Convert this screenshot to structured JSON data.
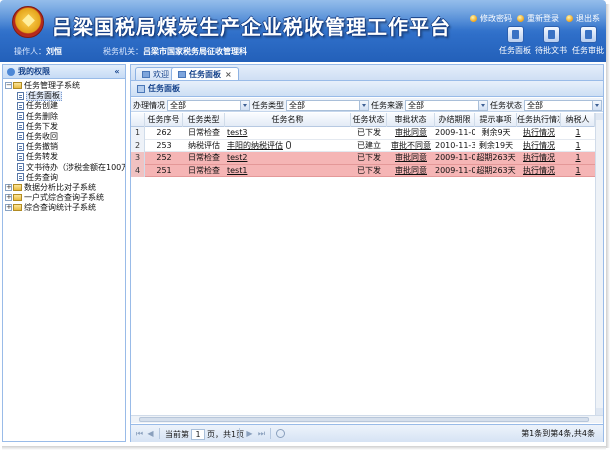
{
  "header": {
    "title": "吕梁国税局煤炭生产企业税收管理工作平台",
    "links": [
      {
        "label": "修改密码"
      },
      {
        "label": "重新登录"
      },
      {
        "label": "退出系"
      }
    ],
    "user_label": "操作人：",
    "user_name": "刘恒",
    "org_label": "税务机关：",
    "org_name": "吕梁市国家税务局征收管理科",
    "quick_buttons": [
      {
        "label": "任务面板"
      },
      {
        "label": "待批文书"
      },
      {
        "label": "任务审批"
      }
    ]
  },
  "sidebar": {
    "title": "我的权限",
    "collapse": "«",
    "tree": [
      {
        "label": "任务管理子系统",
        "level": 0,
        "type": "folder",
        "expanded": true
      },
      {
        "label": "任务面板",
        "level": 1,
        "type": "leaf",
        "selected": true
      },
      {
        "label": "任务创建",
        "level": 1,
        "type": "leaf"
      },
      {
        "label": "任务删除",
        "level": 1,
        "type": "leaf"
      },
      {
        "label": "任务下发",
        "level": 1,
        "type": "leaf"
      },
      {
        "label": "任务收回",
        "level": 1,
        "type": "leaf"
      },
      {
        "label": "任务撤销",
        "level": 1,
        "type": "leaf"
      },
      {
        "label": "任务转发",
        "level": 1,
        "type": "leaf"
      },
      {
        "label": "文书待办（涉税金额在100万",
        "level": 1,
        "type": "leaf"
      },
      {
        "label": "任务查询",
        "level": 1,
        "type": "leaf"
      },
      {
        "label": "数据分析比对子系统",
        "level": 0,
        "type": "folder",
        "expanded": false
      },
      {
        "label": "一户式综合查询子系统",
        "level": 0,
        "type": "folder",
        "expanded": false
      },
      {
        "label": "综合查询统计子系统",
        "level": 0,
        "type": "folder",
        "expanded": false
      }
    ]
  },
  "tabs": [
    {
      "label": "欢迎",
      "active": false
    },
    {
      "label": "任务面板",
      "active": true,
      "close": "×"
    }
  ],
  "panel": {
    "title": "任务面板",
    "filters": [
      {
        "label": "办理情况",
        "value": "全部"
      },
      {
        "label": "任务类型",
        "value": "全部"
      },
      {
        "label": "任务来源",
        "value": "全部"
      },
      {
        "label": "任务状态",
        "value": "全部"
      }
    ],
    "columns": [
      "",
      "任务序号",
      "任务类型",
      "任务名称",
      "任务状态",
      "审批状态",
      "办结期限",
      "提示事项",
      "任务执行情况",
      "纳税人"
    ],
    "rows": [
      {
        "num": "1",
        "id": "262",
        "type": "日常检查",
        "name": "test3",
        "status": "已下发",
        "approval": "审批同意",
        "deadline": "2009-11-01",
        "tip": "剩余9天",
        "exec": "执行情况",
        "taxpayer": "1",
        "alert": false
      },
      {
        "num": "2",
        "id": "253",
        "type": "纳税评估",
        "name": "丰阳的纳税评估",
        "status": "已建立",
        "approval": "审批不同意",
        "deadline": "2010-11-30",
        "tip": "剩余19天",
        "exec": "执行情况",
        "taxpayer": "1",
        "alert": false,
        "attachment": true
      },
      {
        "num": "3",
        "id": "252",
        "type": "日常检查",
        "name": "test2",
        "status": "已下发",
        "approval": "审批同意",
        "deadline": "2009-11-01",
        "tip": "超期263天",
        "exec": "执行情况",
        "taxpayer": "1",
        "alert": true
      },
      {
        "num": "4",
        "id": "251",
        "type": "日常检查",
        "name": "test1",
        "status": "已下发",
        "approval": "审批同意",
        "deadline": "2009-11-01",
        "tip": "超期263天",
        "exec": "执行情况",
        "taxpayer": "1",
        "alert": true
      }
    ]
  },
  "pager": {
    "current_prefix": "当前第",
    "current_page": "1",
    "total_suffix": "页，共1页",
    "info": "第1条到第4条,共4条"
  },
  "colors": {
    "header_blue": "#2f6fc9",
    "panel_border": "#99bbe8",
    "alert_row": "#f5b5b5"
  }
}
